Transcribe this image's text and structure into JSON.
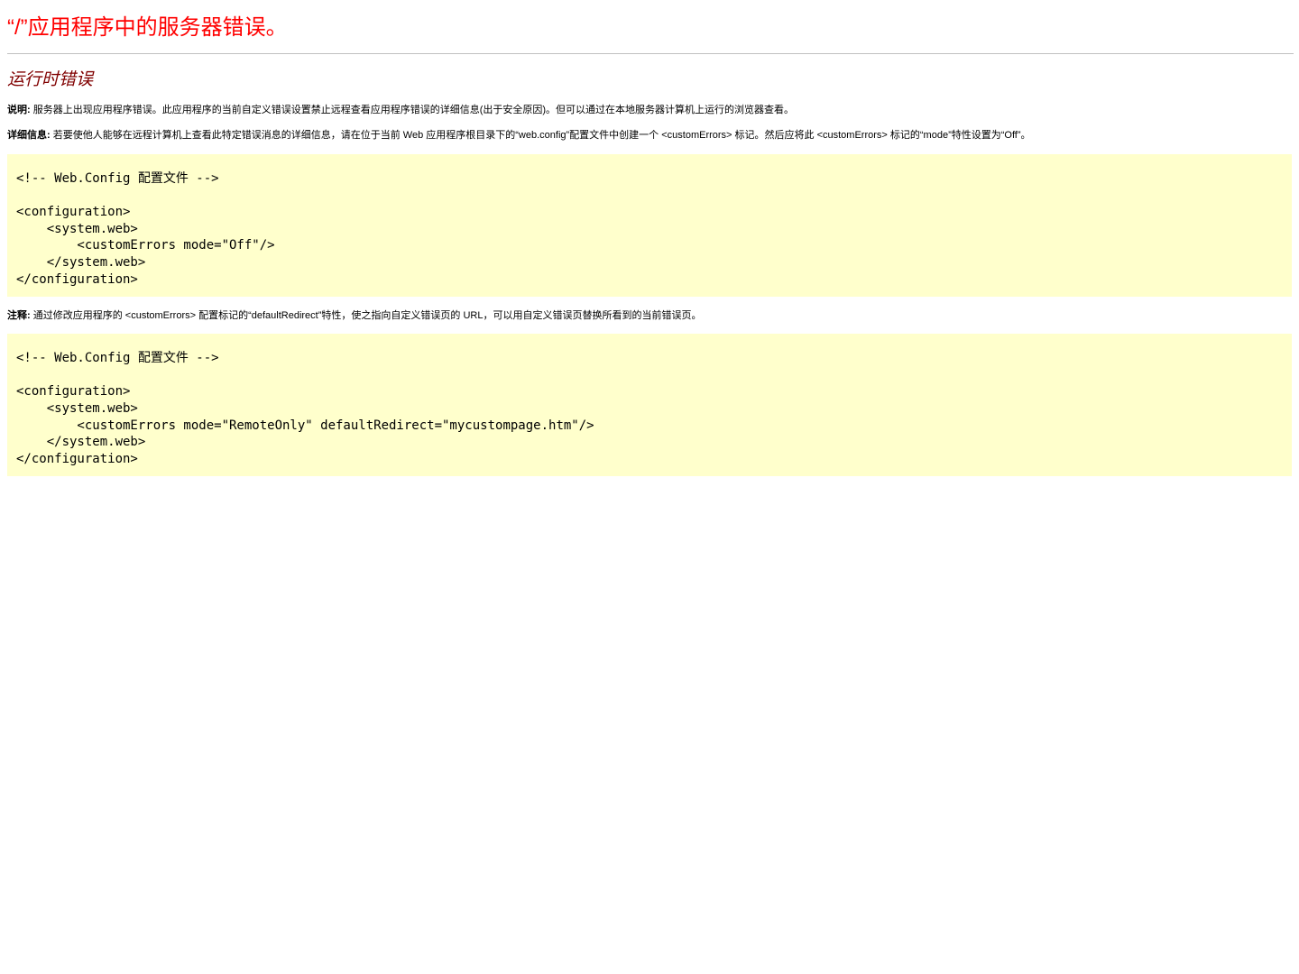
{
  "title": "“/”应用程序中的服务器错误。",
  "subtitle": "运行时错误",
  "description": {
    "label": "说明:",
    "text": " 服务器上出现应用程序错误。此应用程序的当前自定义错误设置禁止远程查看应用程序错误的详细信息(出于安全原因)。但可以通过在本地服务器计算机上运行的浏览器查看。"
  },
  "details": {
    "label": "详细信息:",
    "text": " 若要使他人能够在远程计算机上查看此特定错误消息的详细信息，请在位于当前 Web 应用程序根目录下的“web.config”配置文件中创建一个 <customErrors> 标记。然后应将此 <customErrors> 标记的“mode”特性设置为“Off”。"
  },
  "code_block_1": "<!-- Web.Config 配置文件 -->\n\n<configuration>\n    <system.web>\n        <customErrors mode=\"Off\"/>\n    </system.web>\n</configuration>",
  "notes": {
    "label": "注释:",
    "text": " 通过修改应用程序的 <customErrors> 配置标记的“defaultRedirect”特性，使之指向自定义错误页的 URL，可以用自定义错误页替换所看到的当前错误页。"
  },
  "code_block_2": "<!-- Web.Config 配置文件 -->\n\n<configuration>\n    <system.web>\n        <customErrors mode=\"RemoteOnly\" defaultRedirect=\"mycustompage.htm\"/>\n    </system.web>\n</configuration>",
  "colors": {
    "title": "#ff0000",
    "subtitle": "#800000",
    "code_background": "#ffffcc"
  }
}
